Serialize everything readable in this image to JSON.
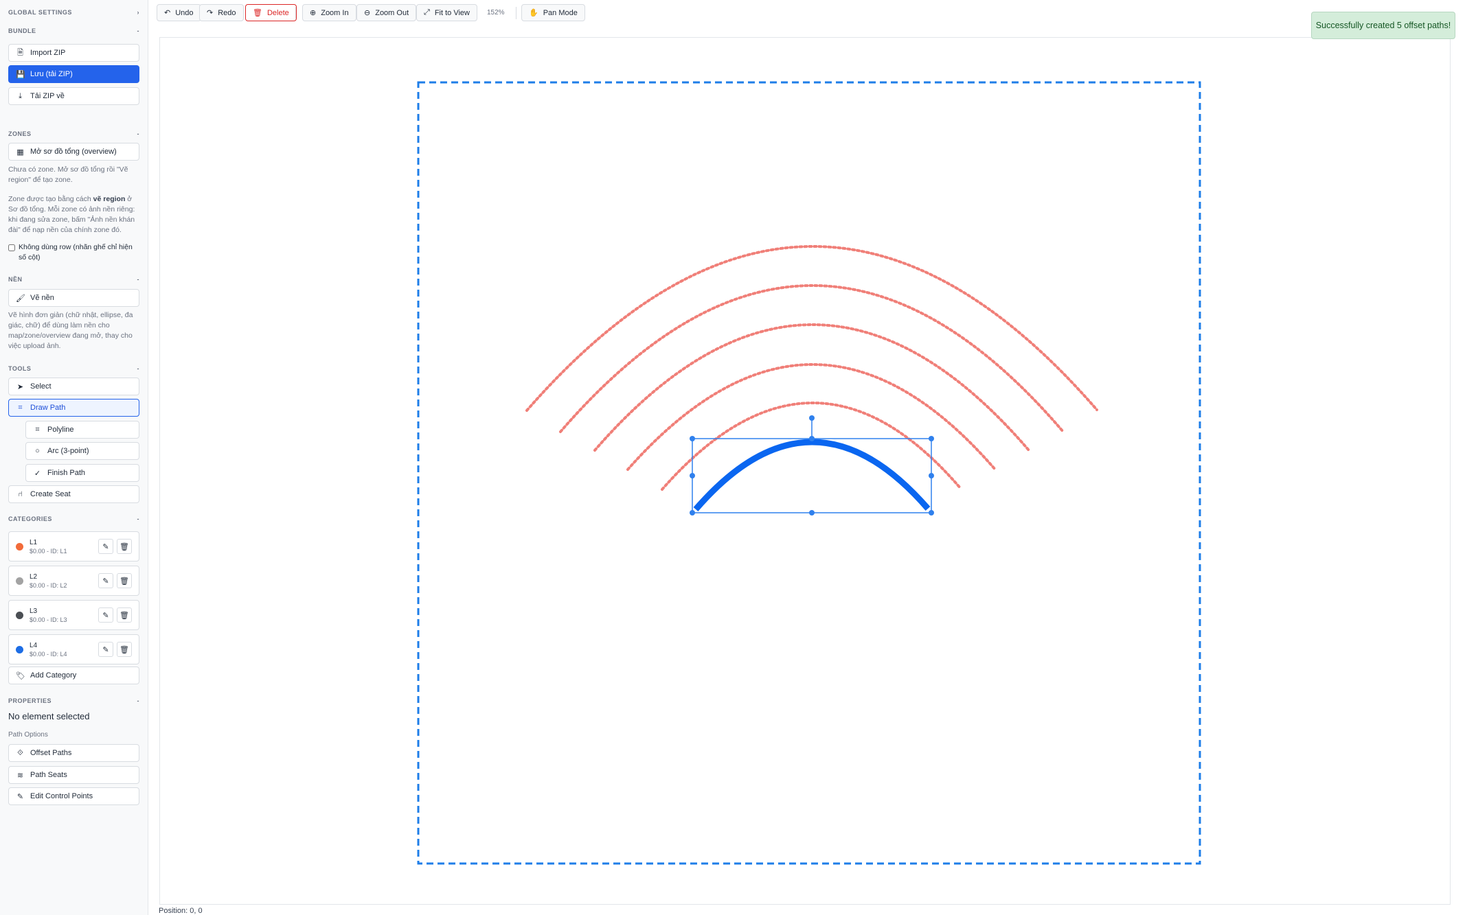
{
  "sidebar": {
    "global_settings": "GLOBAL SETTINGS",
    "bundle": {
      "heading": "BUNDLE",
      "import_zip": "Import ZIP",
      "save_zip": "Lưu (tải ZIP)",
      "download_zip": "Tải ZIP về"
    },
    "zones": {
      "heading": "ZONES",
      "open_overview": "Mở sơ đồ tổng (overview)",
      "note1": "Chưa có zone. Mở sơ đồ tổng rồi \"Vẽ region\" để tạo zone.",
      "note2_pre": "Zone được tạo bằng cách ",
      "note2_bold": "vẽ region",
      "note2_post": " ở Sơ đồ tổng. Mỗi zone có ảnh nền riêng: khi đang sửa zone, bấm \"Ảnh nền khán đài\" để nạp nền của chính zone đó.",
      "checkbox_label": "Không dùng row (nhãn ghế chỉ hiện số cột)"
    },
    "background": {
      "heading": "NỀN",
      "draw_bg": "Vẽ nền",
      "note": "Vẽ hình đơn giản (chữ nhật, ellipse, đa giác, chữ) để dùng làm nền cho map/zone/overview đang mở, thay cho việc upload ảnh."
    },
    "tools": {
      "heading": "TOOLS",
      "select": "Select",
      "draw_path": "Draw Path",
      "polyline": "Polyline",
      "arc": "Arc (3-point)",
      "finish_path": "Finish Path",
      "create_seat": "Create Seat"
    },
    "categories": {
      "heading": "CATEGORIES",
      "items": [
        {
          "name": "L1",
          "sub": "$0.00 - ID: L1",
          "color": "#f26b3a"
        },
        {
          "name": "L2",
          "sub": "$0.00 - ID: L2",
          "color": "#a3a3a3"
        },
        {
          "name": "L3",
          "sub": "$0.00 - ID: L3",
          "color": "#4b4f54"
        },
        {
          "name": "L4",
          "sub": "$0.00 - ID: L4",
          "color": "#1d6de5"
        }
      ],
      "add": "Add Category"
    },
    "properties": {
      "heading": "PROPERTIES",
      "none_selected": "No element selected",
      "path_options": "Path Options",
      "offset_paths": "Offset Paths",
      "path_seats": "Path Seats",
      "edit_control_points": "Edit Control Points"
    }
  },
  "toolbar": {
    "undo": "Undo",
    "redo": "Redo",
    "delete": "Delete",
    "zoom_in": "Zoom In",
    "zoom_out": "Zoom Out",
    "fit": "Fit to View",
    "zoom_level": "152%",
    "pan": "Pan Mode"
  },
  "toast": "Successfully created 5 offset paths!",
  "position": "Position: 0, 0",
  "colors": {
    "accent": "#2463eb",
    "path": "#0a66f0",
    "offset": "#f07f78",
    "zone_border": "#1e7ee8"
  }
}
